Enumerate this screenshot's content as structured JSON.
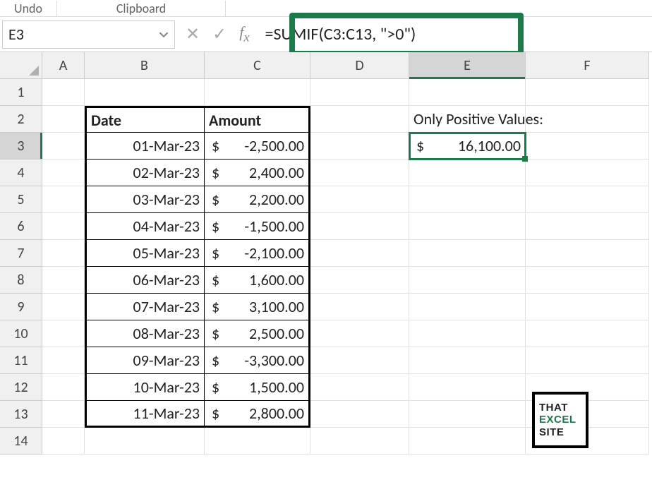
{
  "ribbon": {
    "undo": "Undo",
    "clipboard": "Clipboard"
  },
  "name_box": "E3",
  "formula": "=SUMIF(C3:C13, \">0\")",
  "col_headers": [
    "A",
    "B",
    "C",
    "D",
    "E",
    "F"
  ],
  "row_headers": [
    "1",
    "2",
    "3",
    "4",
    "5",
    "6",
    "7",
    "8",
    "9",
    "10",
    "11",
    "12",
    "13",
    "14"
  ],
  "table": {
    "head_date": "Date",
    "head_amount": "Amount",
    "rows": [
      {
        "date": "01-Mar-23",
        "amount": "-2,500.00"
      },
      {
        "date": "02-Mar-23",
        "amount": "2,400.00"
      },
      {
        "date": "03-Mar-23",
        "amount": "2,200.00"
      },
      {
        "date": "04-Mar-23",
        "amount": "-1,500.00"
      },
      {
        "date": "05-Mar-23",
        "amount": "-2,100.00"
      },
      {
        "date": "06-Mar-23",
        "amount": "1,600.00"
      },
      {
        "date": "07-Mar-23",
        "amount": "3,100.00"
      },
      {
        "date": "08-Mar-23",
        "amount": "2,500.00"
      },
      {
        "date": "09-Mar-23",
        "amount": "-3,300.00"
      },
      {
        "date": "10-Mar-23",
        "amount": "1,500.00"
      },
      {
        "date": "11-Mar-23",
        "amount": "2,800.00"
      }
    ]
  },
  "result": {
    "label": "Only Positive Values:",
    "value": "16,100.00"
  },
  "currency_symbol": "$",
  "logo": {
    "l1": "THAT",
    "l2": "EXCEL",
    "l3": "SITE"
  }
}
